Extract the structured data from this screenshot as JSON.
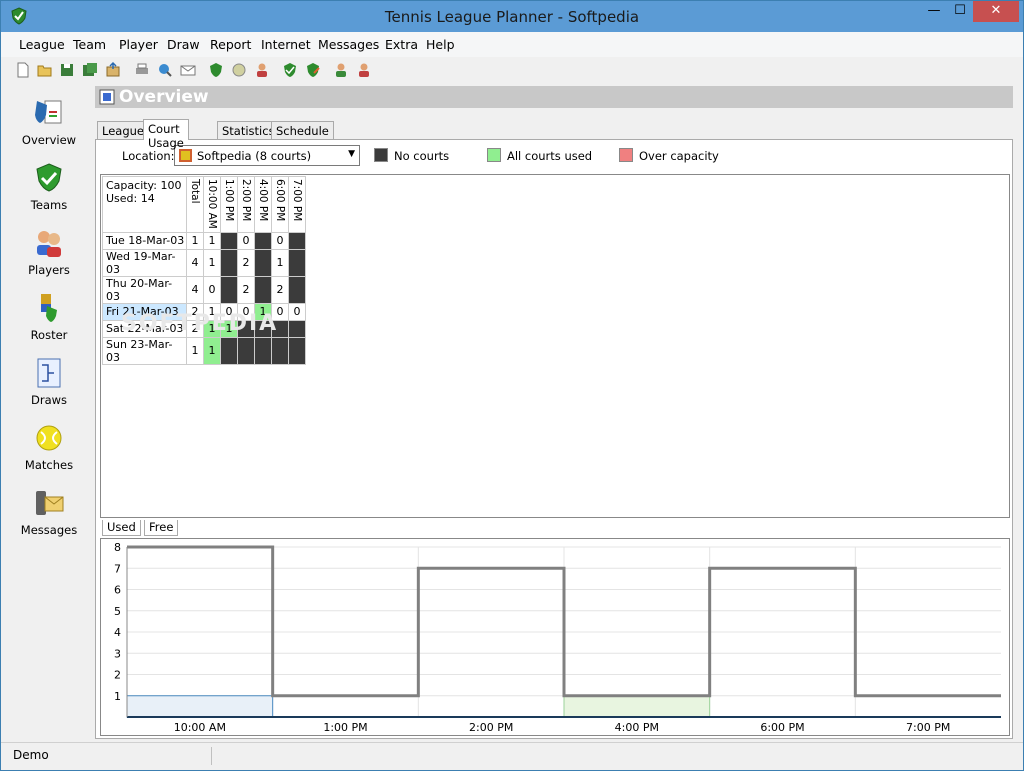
{
  "window": {
    "title": "Tennis League Planner - Softpedia"
  },
  "menu": [
    "League",
    "Team",
    "Player",
    "Draw",
    "Report",
    "Internet",
    "Messages",
    "Extra",
    "Help"
  ],
  "sidebar": [
    {
      "label": "Overview",
      "icon": "overview-icon"
    },
    {
      "label": "Teams",
      "icon": "teams-icon"
    },
    {
      "label": "Players",
      "icon": "players-icon"
    },
    {
      "label": "Roster",
      "icon": "roster-icon"
    },
    {
      "label": "Draws",
      "icon": "draws-icon"
    },
    {
      "label": "Matches",
      "icon": "matches-icon"
    },
    {
      "label": "Messages",
      "icon": "messages-icon"
    }
  ],
  "header": {
    "title": "Overview"
  },
  "tabs": [
    "League",
    "Court Usage",
    "Statistics",
    "Schedule"
  ],
  "location": {
    "label": "Location:",
    "value": "Softpedia (8 courts)"
  },
  "legend": [
    {
      "label": "No courts",
      "color": "#3b3b3b"
    },
    {
      "label": "All courts used",
      "color": "#90ee90"
    },
    {
      "label": "Over capacity",
      "color": "#f08080"
    }
  ],
  "grid": {
    "capacity": "Capacity: 100",
    "used": "Used: 14",
    "total_header": "Total",
    "time_headers": [
      "10:00 AM",
      "1:00 PM",
      "2:00 PM",
      "4:00 PM",
      "6:00 PM",
      "7:00 PM"
    ],
    "rows": [
      {
        "day": "Tue 18-Mar-03",
        "total": "1",
        "cells": [
          [
            "1",
            ""
          ],
          [
            "",
            "dk"
          ],
          [
            "0",
            ""
          ],
          [
            "",
            "dk"
          ],
          [
            "0",
            ""
          ],
          [
            "",
            "dk"
          ]
        ]
      },
      {
        "day": "Wed 19-Mar-03",
        "total": "4",
        "cells": [
          [
            "1",
            ""
          ],
          [
            "",
            "dk"
          ],
          [
            "2",
            ""
          ],
          [
            "",
            "dk"
          ],
          [
            "1",
            ""
          ],
          [
            "",
            "dk"
          ]
        ]
      },
      {
        "day": "Thu 20-Mar-03",
        "total": "4",
        "cells": [
          [
            "0",
            ""
          ],
          [
            "",
            "dk"
          ],
          [
            "2",
            ""
          ],
          [
            "",
            "dk"
          ],
          [
            "2",
            ""
          ],
          [
            "",
            "dk"
          ]
        ]
      },
      {
        "day": "Fri 21-Mar-03",
        "total": "2",
        "selected": true,
        "cells": [
          [
            "1",
            ""
          ],
          [
            "0",
            ""
          ],
          [
            "0",
            ""
          ],
          [
            "1",
            "gr"
          ],
          [
            "0",
            ""
          ],
          [
            "0",
            ""
          ]
        ]
      },
      {
        "day": "Sat 22-Mar-03",
        "total": "2",
        "cells": [
          [
            "1",
            "gr"
          ],
          [
            "1",
            "gr"
          ],
          [
            "",
            "dk"
          ],
          [
            "",
            "dk"
          ],
          [
            "",
            "dk"
          ],
          [
            "",
            "dk"
          ]
        ]
      },
      {
        "day": "Sun 23-Mar-03",
        "total": "1",
        "cells": [
          [
            "1",
            "gr"
          ],
          [
            "",
            "dk"
          ],
          [
            "",
            "dk"
          ],
          [
            "",
            "dk"
          ],
          [
            "",
            "dk"
          ],
          [
            "",
            "dk"
          ]
        ]
      }
    ]
  },
  "chart_tabs": [
    "Used",
    "Free"
  ],
  "chart_data": {
    "type": "line",
    "step": true,
    "x": [
      "10:00 AM",
      "1:00 PM",
      "2:00 PM",
      "4:00 PM",
      "6:00 PM",
      "7:00 PM"
    ],
    "ylim": [
      0,
      8
    ],
    "yticks": [
      1,
      2,
      3,
      4,
      5,
      6,
      7,
      8
    ],
    "series": [
      {
        "values": [
          8,
          1,
          7,
          1,
          7,
          1
        ],
        "color": "#808080"
      },
      {
        "values": [
          1,
          0,
          0,
          1,
          0,
          0
        ],
        "fill": [
          "#e8f0f8",
          "",
          "",
          "#e8f5e0",
          "",
          ""
        ]
      }
    ],
    "grid": true
  },
  "status": {
    "text": "Demo"
  }
}
